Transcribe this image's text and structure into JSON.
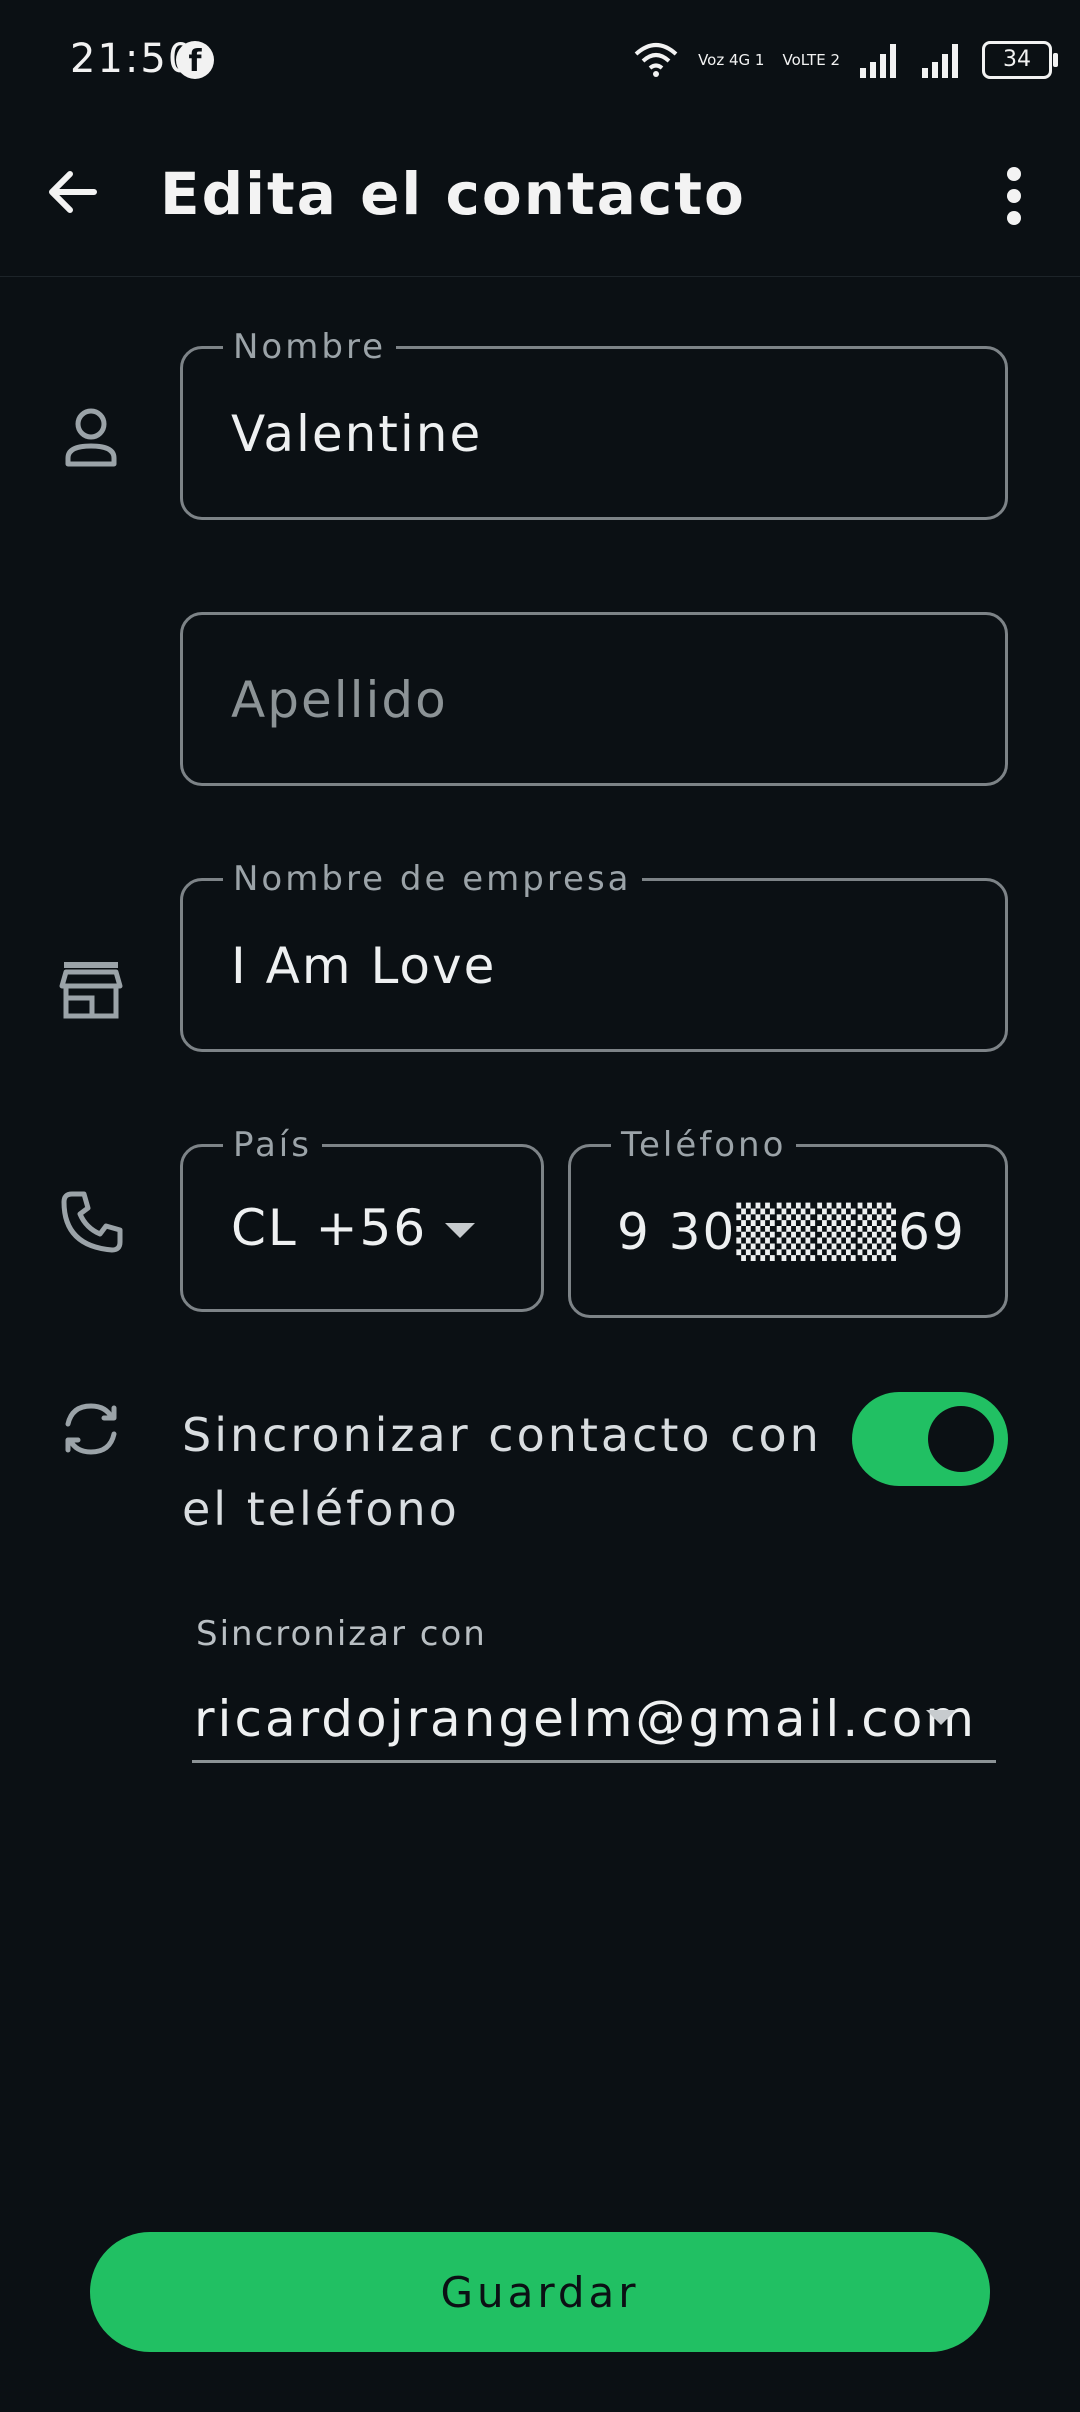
{
  "status_bar": {
    "time": "21:50",
    "network_label_1": "Voz 4G 1",
    "network_label_2": "VoLTE 2",
    "battery": "34"
  },
  "app_bar": {
    "title": "Edita el contacto"
  },
  "form": {
    "first_name": {
      "label": "Nombre",
      "value": "Valentine"
    },
    "last_name": {
      "placeholder": "Apellido"
    },
    "company": {
      "label": "Nombre de empresa",
      "value": "I Am Love"
    },
    "country": {
      "label": "País",
      "value": "CL +56"
    },
    "phone": {
      "label": "Teléfono",
      "value": "9 30▒▒▒▒69"
    },
    "sync": {
      "label": "Sincronizar contacto con el teléfono",
      "enabled": true
    },
    "sync_with": {
      "label": "Sincronizar con",
      "value": "ricardojrangelm@gmail.com"
    }
  },
  "actions": {
    "save_label": "Guardar"
  },
  "colors": {
    "background": "#0b1014",
    "accent": "#21c063",
    "outline": "#7d8387"
  }
}
